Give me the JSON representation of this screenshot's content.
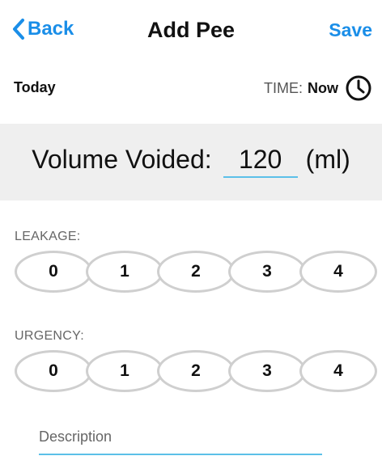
{
  "nav": {
    "back_label": "Back",
    "title": "Add Pee",
    "save_label": "Save"
  },
  "date_row": {
    "date_label": "Today",
    "time_prefix": "TIME:",
    "time_value": "Now"
  },
  "volume": {
    "label": "Volume Voided:",
    "value": "120",
    "unit": "(ml)"
  },
  "leakage": {
    "label": "LEAKAGE:",
    "options": [
      "0",
      "1",
      "2",
      "3",
      "4"
    ]
  },
  "urgency": {
    "label": "URGENCY:",
    "options": [
      "0",
      "1",
      "2",
      "3",
      "4"
    ]
  },
  "description": {
    "placeholder": "Description"
  },
  "colors": {
    "accent": "#1a8ee8",
    "input_underline": "#5bc0e8",
    "panel_bg": "#efefef",
    "pill_border": "#cfcfcf"
  }
}
